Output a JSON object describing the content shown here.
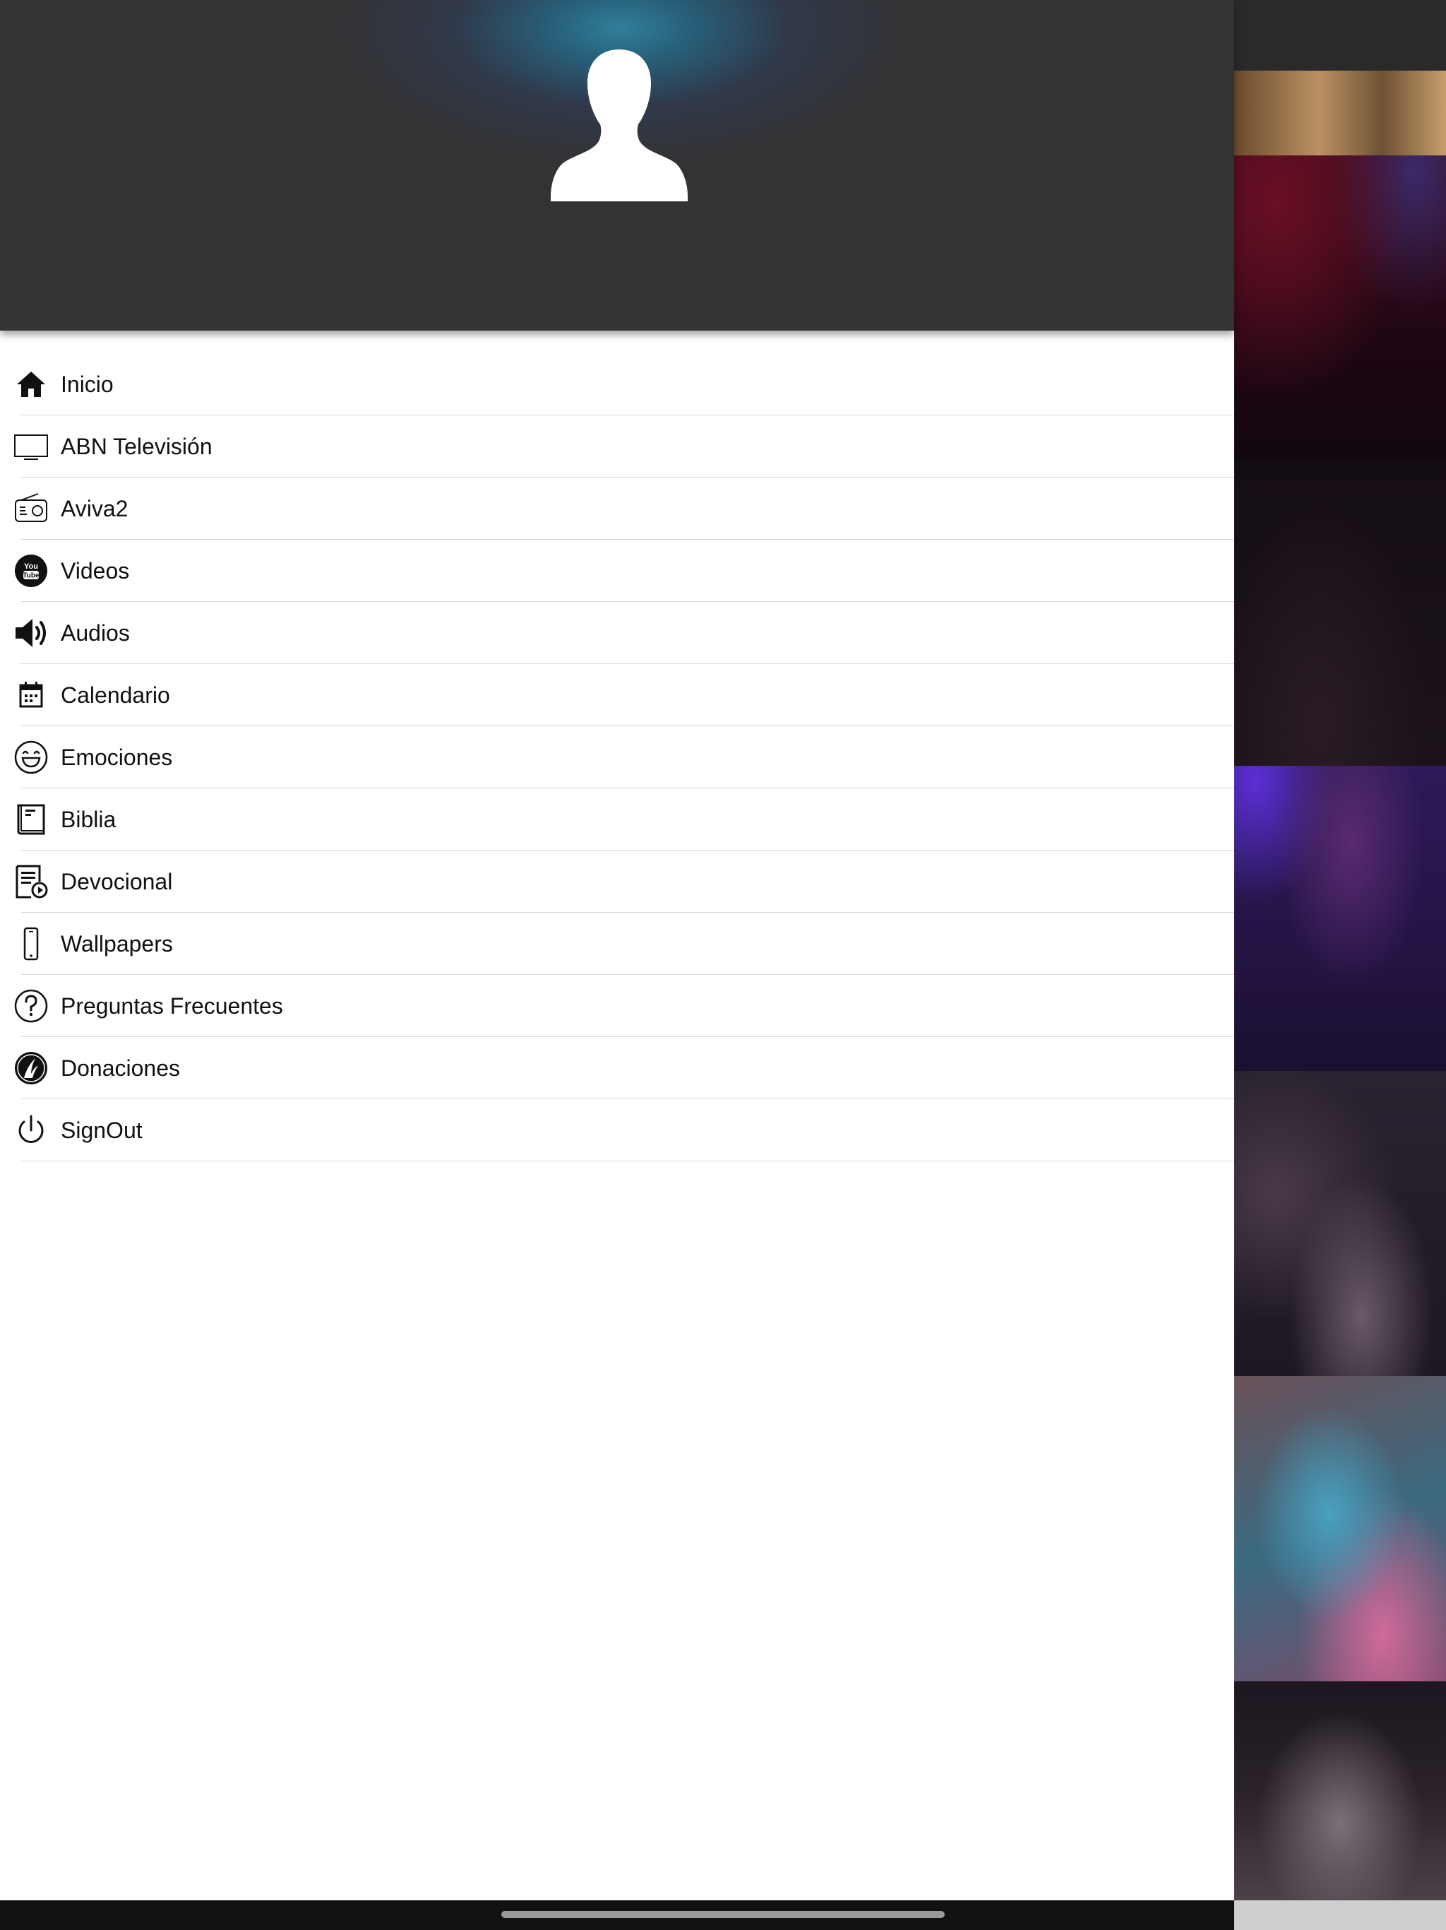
{
  "drawer": {
    "avatar_icon": "default-user-avatar",
    "menu_items": [
      {
        "id": "inicio",
        "label": "Inicio",
        "icon": "home-icon"
      },
      {
        "id": "abn-television",
        "label": "ABN Televisión",
        "icon": "tv-icon"
      },
      {
        "id": "aviva2",
        "label": "Aviva2",
        "icon": "radio-icon"
      },
      {
        "id": "videos",
        "label": "Videos",
        "icon": "youtube-icon"
      },
      {
        "id": "audios",
        "label": "Audios",
        "icon": "speaker-icon"
      },
      {
        "id": "calendario",
        "label": "Calendario",
        "icon": "calendar-icon"
      },
      {
        "id": "emociones",
        "label": "Emociones",
        "icon": "smiley-icon"
      },
      {
        "id": "biblia",
        "label": "Biblia",
        "icon": "book-icon"
      },
      {
        "id": "devocional",
        "label": "Devocional",
        "icon": "devotional-icon"
      },
      {
        "id": "wallpapers",
        "label": "Wallpapers",
        "icon": "phone-icon"
      },
      {
        "id": "preguntas-frecuentes",
        "label": "Preguntas Frecuentes",
        "icon": "question-icon"
      },
      {
        "id": "donaciones",
        "label": "Donaciones",
        "icon": "donation-icon"
      },
      {
        "id": "signout",
        "label": "SignOut",
        "icon": "power-icon"
      }
    ]
  },
  "colors": {
    "header_bg": "#333335",
    "header_glow": "#2f7f9a",
    "menu_text": "#111111",
    "divider": "#d8d8d8"
  }
}
